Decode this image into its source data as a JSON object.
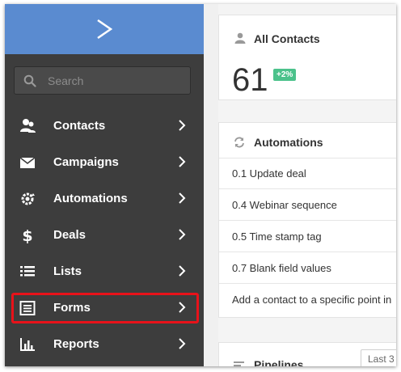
{
  "brand": {
    "logo": "activecampaign-chevron-logo",
    "color": "#5a8bd0"
  },
  "search": {
    "placeholder": "Search"
  },
  "nav": [
    {
      "label": "Contacts",
      "icon": "contacts-icon"
    },
    {
      "label": "Campaigns",
      "icon": "envelope-icon"
    },
    {
      "label": "Automations",
      "icon": "automation-gear-icon"
    },
    {
      "label": "Deals",
      "icon": "dollar-icon"
    },
    {
      "label": "Lists",
      "icon": "list-icon"
    },
    {
      "label": "Forms",
      "icon": "form-icon",
      "highlighted": true
    },
    {
      "label": "Reports",
      "icon": "bar-chart-icon"
    }
  ],
  "highlight_color": "#e8121a",
  "contacts_card": {
    "title": "All Contacts",
    "count": "61",
    "change": "+2%"
  },
  "automations_card": {
    "title": "Automations",
    "items": [
      "0.1 Update deal",
      "0.4 Webinar sequence",
      "0.5 Time stamp tag",
      "0.7 Blank field values",
      "Add a contact to a specific point in"
    ]
  },
  "pipelines_card": {
    "title": "Pipelines",
    "select_value": "Last 3"
  }
}
